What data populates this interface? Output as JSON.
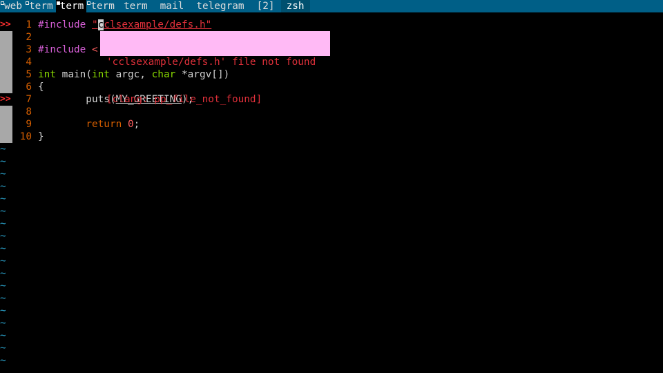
{
  "tabbar": {
    "tabs": [
      {
        "label": "web",
        "flagged": true,
        "active": false
      },
      {
        "label": "term",
        "flagged": true,
        "active": false
      },
      {
        "label": "term",
        "flagged": true,
        "active": true
      },
      {
        "label": "term",
        "flagged": true,
        "active": false
      },
      {
        "label": "term",
        "flagged": false,
        "active": false
      },
      {
        "label": "mail",
        "flagged": false,
        "active": false
      },
      {
        "label": "telegram",
        "flagged": false,
        "active": false
      },
      {
        "label": "[2]",
        "flagged": false,
        "active": false
      }
    ],
    "shell_label": "zsh"
  },
  "editor": {
    "lines": [
      {
        "num": "1",
        "sign": ">>"
      },
      {
        "num": "2",
        "sign": ""
      },
      {
        "num": "3",
        "sign": ""
      },
      {
        "num": "4",
        "sign": ""
      },
      {
        "num": "5",
        "sign": ""
      },
      {
        "num": "6",
        "sign": ""
      },
      {
        "num": "7",
        "sign": ">>"
      },
      {
        "num": "8",
        "sign": ""
      },
      {
        "num": "9",
        "sign": ""
      },
      {
        "num": "10",
        "sign": ""
      }
    ],
    "code": {
      "l1_directive": "#include ",
      "l1_quote_open": "\"",
      "l1_cursor_char": "c",
      "l1_path_rest": "clsexample/defs.h\"",
      "l3_directive": "#include ",
      "l3_angle": "<",
      "l5_type1": "int",
      "l5_name": " main(",
      "l5_type2": "int",
      "l5_argc": " argc, ",
      "l5_type3": "char",
      "l5_argv": " *argv[])",
      "l6": "{",
      "l7_indent": "        puts(",
      "l7_macro": "MY_GREETING",
      "l7_end": ");",
      "l9_indent": "        ",
      "l9_kw": "return",
      "l9_space": " ",
      "l9_num": "0",
      "l9_end": ";",
      "l10": "}"
    },
    "empty_marker": "~",
    "empty_rows": 18
  },
  "diagnostic": {
    "line1": "'cclsexample/defs.h' file not found",
    "line2": "[clang: pp_file_not_found]"
  },
  "colors": {
    "tabbar_bg": "#005f87",
    "error": "#e0303a",
    "popup_bg": "#ffbaf5",
    "line_number": "#d75f00",
    "tilde": "#2aa1c9"
  }
}
